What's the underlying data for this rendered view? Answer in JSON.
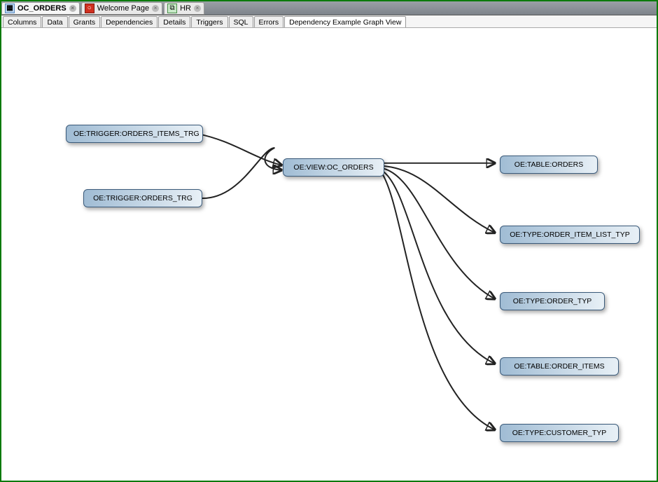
{
  "doc_tabs": [
    {
      "label": "OC_ORDERS",
      "icon": "table-icon",
      "active": true
    },
    {
      "label": "Welcome Page",
      "icon": "oracle-icon",
      "active": false
    },
    {
      "label": "HR",
      "icon": "sql-icon",
      "active": false
    }
  ],
  "view_tabs": [
    {
      "label": "Columns"
    },
    {
      "label": "Data"
    },
    {
      "label": "Grants"
    },
    {
      "label": "Dependencies"
    },
    {
      "label": "Details"
    },
    {
      "label": "Triggers"
    },
    {
      "label": "SQL"
    },
    {
      "label": "Errors"
    },
    {
      "label": "Dependency Example Graph View",
      "active": true
    }
  ],
  "nodes": {
    "trigger_items": "OE:TRIGGER:ORDERS_ITEMS_TRG",
    "trigger_orders": "OE:TRIGGER:ORDERS_TRG",
    "view_oc_orders": "OE:VIEW:OC_ORDERS",
    "table_orders": "OE:TABLE:ORDERS",
    "type_item_list": "OE:TYPE:ORDER_ITEM_LIST_TYP",
    "type_order": "OE:TYPE:ORDER_TYP",
    "table_order_items": "OE:TABLE:ORDER_ITEMS",
    "type_customer": "OE:TYPE:CUSTOMER_TYP"
  },
  "chart_data": {
    "type": "diagram",
    "title": "Dependency Example Graph View",
    "nodes": [
      {
        "id": "trigger_items",
        "label": "OE:TRIGGER:ORDERS_ITEMS_TRG",
        "kind": "TRIGGER"
      },
      {
        "id": "trigger_orders",
        "label": "OE:TRIGGER:ORDERS_TRG",
        "kind": "TRIGGER"
      },
      {
        "id": "view_oc_orders",
        "label": "OE:VIEW:OC_ORDERS",
        "kind": "VIEW"
      },
      {
        "id": "table_orders",
        "label": "OE:TABLE:ORDERS",
        "kind": "TABLE"
      },
      {
        "id": "type_item_list",
        "label": "OE:TYPE:ORDER_ITEM_LIST_TYP",
        "kind": "TYPE"
      },
      {
        "id": "type_order",
        "label": "OE:TYPE:ORDER_TYP",
        "kind": "TYPE"
      },
      {
        "id": "table_order_items",
        "label": "OE:TABLE:ORDER_ITEMS",
        "kind": "TABLE"
      },
      {
        "id": "type_customer",
        "label": "OE:TYPE:CUSTOMER_TYP",
        "kind": "TYPE"
      }
    ],
    "edges": [
      {
        "from": "trigger_items",
        "to": "view_oc_orders"
      },
      {
        "from": "trigger_orders",
        "to": "view_oc_orders"
      },
      {
        "from": "view_oc_orders",
        "to": "table_orders"
      },
      {
        "from": "view_oc_orders",
        "to": "type_item_list"
      },
      {
        "from": "view_oc_orders",
        "to": "type_order"
      },
      {
        "from": "view_oc_orders",
        "to": "table_order_items"
      },
      {
        "from": "view_oc_orders",
        "to": "type_customer"
      }
    ]
  }
}
